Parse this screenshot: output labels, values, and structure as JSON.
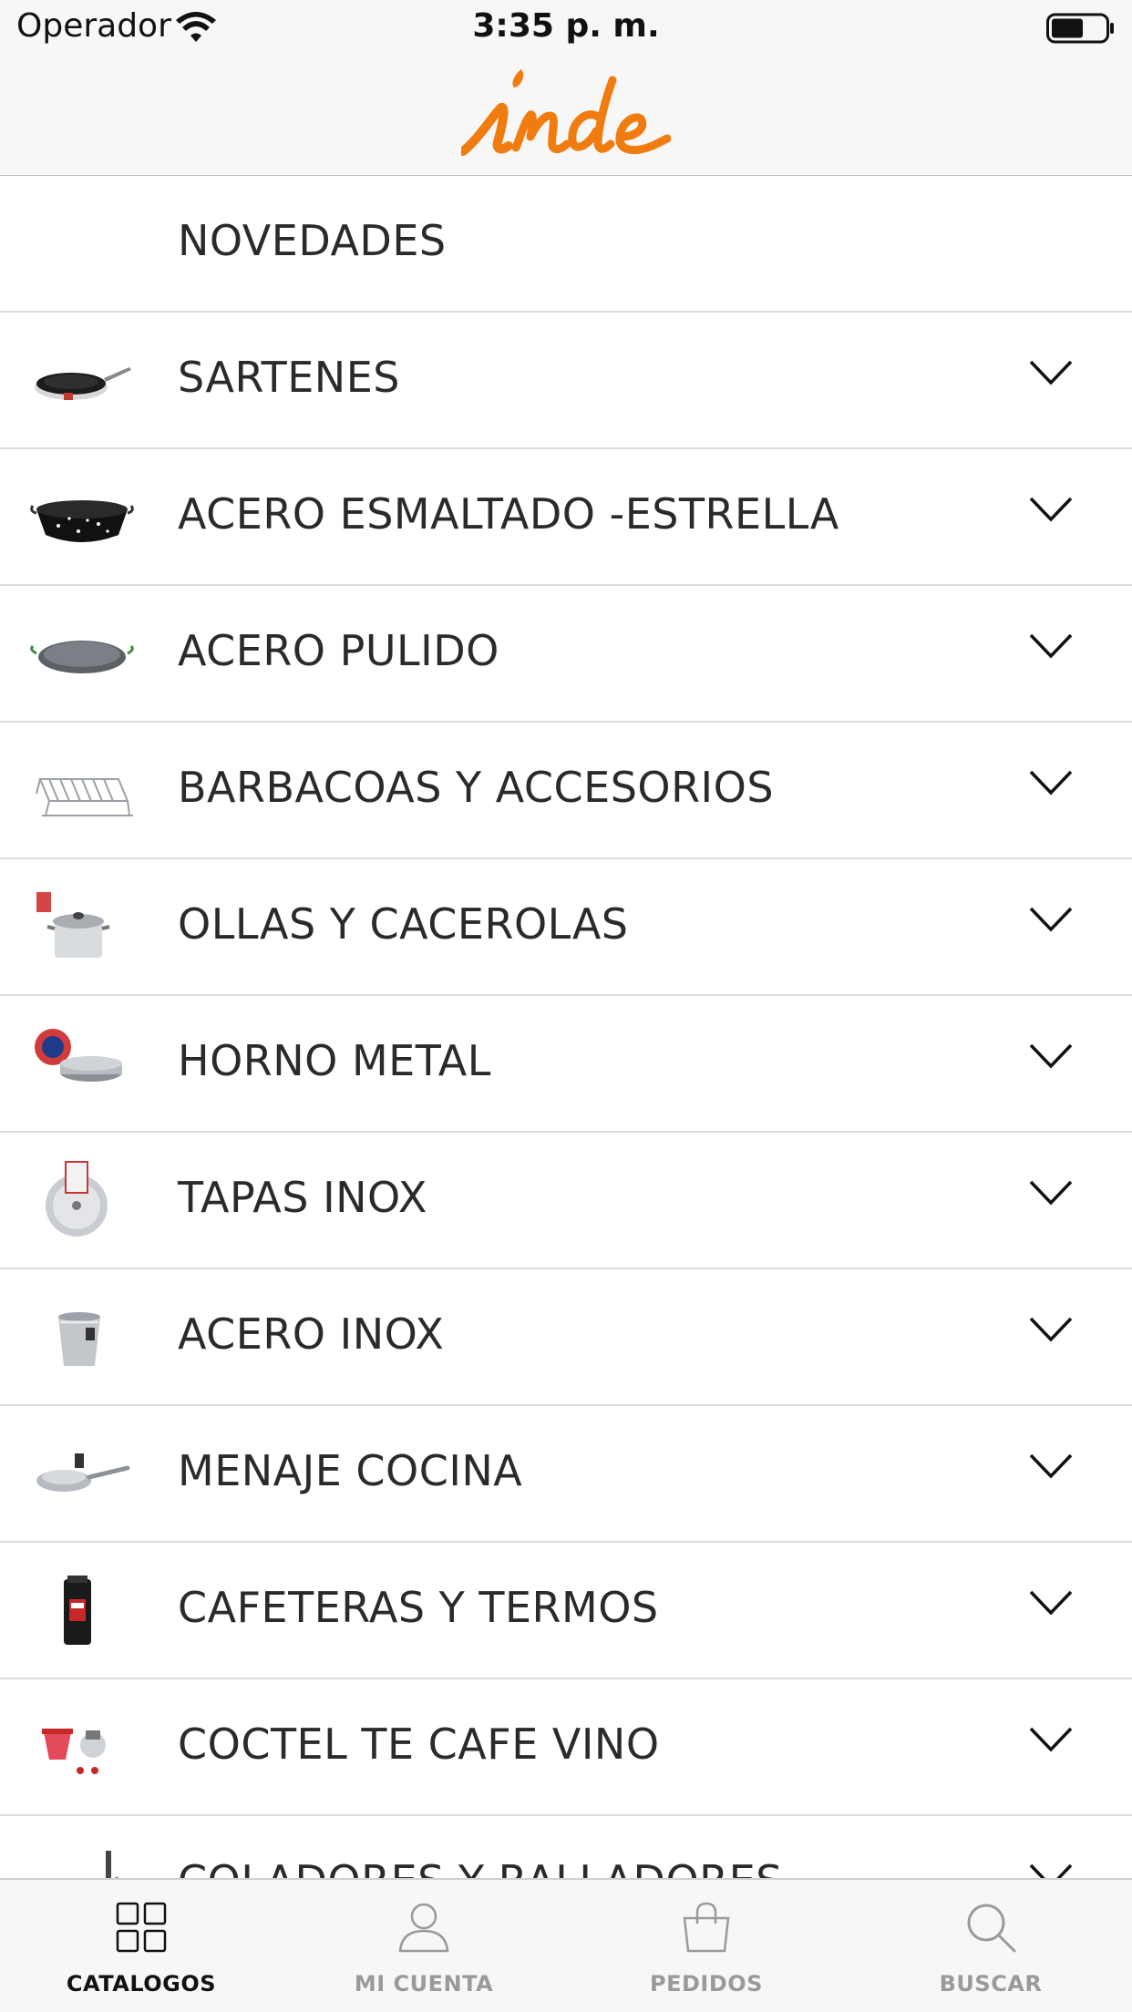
{
  "status_bar": {
    "carrier": "Operador",
    "time": "3:35 p. m."
  },
  "header": {
    "logo_text": "inde",
    "logo_color": "#f07c0f"
  },
  "catalog": {
    "items": [
      {
        "label": "NOVEDADES",
        "icon": "none",
        "expandable": false
      },
      {
        "label": "SARTENES",
        "icon": "frying-pan-icon",
        "expandable": true
      },
      {
        "label": "ACERO ESMALTADO -ESTRELLA",
        "icon": "enameled-paella-pan-icon",
        "expandable": true
      },
      {
        "label": "ACERO PULIDO",
        "icon": "polished-paella-pan-icon",
        "expandable": true
      },
      {
        "label": "BARBACOAS Y ACCESORIOS",
        "icon": "grill-rack-icon",
        "expandable": true
      },
      {
        "label": "OLLAS Y CACEROLAS",
        "icon": "cooking-pot-icon",
        "expandable": true
      },
      {
        "label": "HORNO METAL",
        "icon": "baking-mold-icon",
        "expandable": true
      },
      {
        "label": "TAPAS INOX",
        "icon": "lid-icon",
        "expandable": true
      },
      {
        "label": "ACERO INOX",
        "icon": "steel-bucket-icon",
        "expandable": true
      },
      {
        "label": "MENAJE COCINA",
        "icon": "kitchen-utensil-icon",
        "expandable": true
      },
      {
        "label": "CAFETERAS Y TERMOS",
        "icon": "thermos-icon",
        "expandable": true
      },
      {
        "label": "COCTEL TE CAFE VINO",
        "icon": "cocktail-set-icon",
        "expandable": true
      },
      {
        "label": "COLADORES Y RALLADORES",
        "icon": "strainer-icon",
        "expandable": true
      }
    ]
  },
  "tab_bar": {
    "active_color": "#111111",
    "inactive_color": "#9a9a9a",
    "tabs": [
      {
        "label": "CATALOGOS",
        "icon": "grid-icon",
        "active": true
      },
      {
        "label": "MI CUENTA",
        "icon": "user-icon",
        "active": false
      },
      {
        "label": "PEDIDOS",
        "icon": "shopping-bag-icon",
        "active": false
      },
      {
        "label": "BUSCAR",
        "icon": "search-icon",
        "active": false
      }
    ]
  }
}
